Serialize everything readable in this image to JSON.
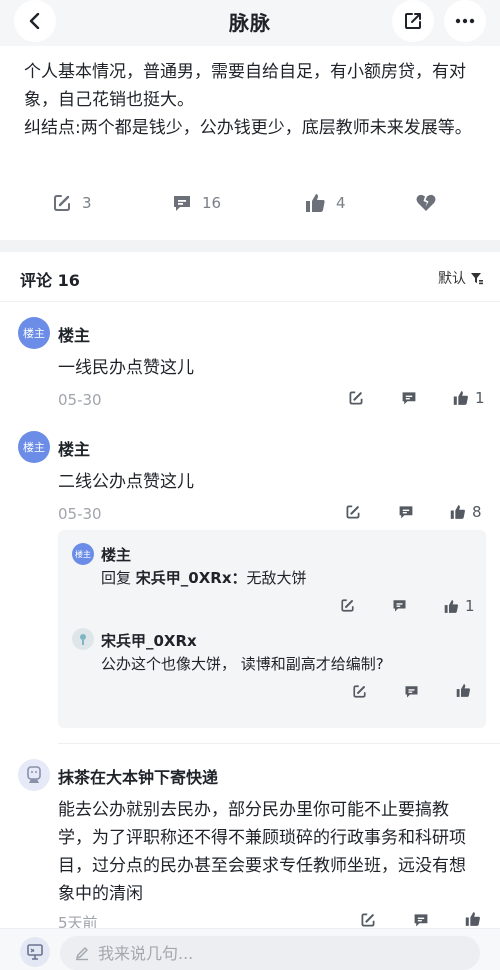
{
  "header": {
    "title": "脉脉"
  },
  "post": {
    "lines": [
      "个人基本情况，普通男，需要自给自足，有小额房贷，有对象，自己花销也挺大。",
      "纠结点:两个都是钱少，公办钱更少，底层教师未来发展等。"
    ],
    "actions": {
      "share_count": "3",
      "comment_count": "16",
      "like_count": "4"
    }
  },
  "comments_header": {
    "title": "评论 16",
    "sort_label": "默认"
  },
  "comments": [
    {
      "avatar_text": "楼主",
      "name": "楼主",
      "text": "一线民办点赞这儿",
      "date": "05-30",
      "likes": "1"
    },
    {
      "avatar_text": "楼主",
      "name": "楼主",
      "text": "二线公办点赞这儿",
      "date": "05-30",
      "likes": "8"
    },
    {
      "name": "抹茶在大本钟下寄快递",
      "text": "能去公办就别去民办，部分民办里你可能不止要搞教学，为了评职称还不得不兼顾琐碎的行政事务和科研项目，过分点的民办甚至会要求专任教师坐班，远没有想象中的清闲",
      "date": "5天前"
    }
  ],
  "replies": [
    {
      "avatar_text": "楼主",
      "name": "楼主",
      "reply_prefix": "回复",
      "reply_to": "宋兵甲_0XRx：",
      "text": "无敌大饼",
      "likes": "1"
    },
    {
      "name": "宋兵甲_0XRx",
      "text": "公办这个也像大饼， 读博和副高才给编制?"
    }
  ],
  "input": {
    "placeholder": "我来说几句..."
  },
  "colors": {
    "accent_avatar": "#6b8de8",
    "page_bg": "#f5f6f8",
    "muted_text": "#a0a4ab"
  }
}
